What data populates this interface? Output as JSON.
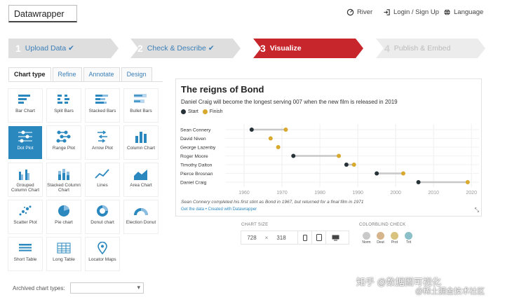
{
  "app": {
    "logo": "Datawrapper",
    "nav": [
      {
        "label": "River",
        "icon": "river-icon"
      },
      {
        "label": "Login / Sign Up",
        "icon": "login-icon"
      },
      {
        "label": "Language",
        "icon": "globe-icon"
      }
    ]
  },
  "steps": [
    {
      "num": "1",
      "label": "Upload Data",
      "state": "done"
    },
    {
      "num": "2",
      "label": "Check & Describe",
      "state": "done"
    },
    {
      "num": "3",
      "label": "Visualize",
      "state": "active"
    },
    {
      "num": "4",
      "label": "Publish & Embed",
      "state": "todo"
    }
  ],
  "tabs": [
    "Chart type",
    "Refine",
    "Annotate",
    "Design"
  ],
  "chart_types": [
    "Bar Chart",
    "Split Bars",
    "Stacked Bars",
    "Bullet Bars",
    "Dot Plot",
    "Range Plot",
    "Arrow Plot",
    "Column Chart",
    "Grouped Column Chart",
    "Stacked Column Chart",
    "Lines",
    "Area Chart",
    "Scatter Plot",
    "Pie chart",
    "Donut chart",
    "Election Donut",
    "Short Table",
    "Long Table",
    "Locator Maps"
  ],
  "selected_chart_type": "Dot Plot",
  "archived_label": "Archived chart types:",
  "colors": {
    "accent": "#c8262d",
    "selected": "#2b88bf",
    "start": "#263238",
    "finish": "#d8a92c",
    "link": "#3b7fb8"
  },
  "preview": {
    "title": "The reigns of Bond",
    "description": "Daniel Craig will become the longest serving 007 when the new film is released in 2019",
    "notes": "Sean Connery completed his first stint as Bond in 1967, but returned for a final film in 1971",
    "source": "Get the data • Created with Datawrapper"
  },
  "chart_data": {
    "type": "scatter",
    "title": "The reigns of Bond",
    "subtitle": "Daniel Craig will become the longest serving 007 when the new film is released in 2019",
    "legend": [
      {
        "name": "Start",
        "color": "#263238"
      },
      {
        "name": "Finish",
        "color": "#d8a92c"
      }
    ],
    "xlim": [
      1955,
      2022
    ],
    "x_ticks": [
      1960,
      1970,
      1980,
      1990,
      2000,
      2010,
      2020
    ],
    "rows": [
      {
        "name": "Sean Connery",
        "start": 1962,
        "finish": 1971
      },
      {
        "name": "David Niven",
        "start": null,
        "finish": 1967
      },
      {
        "name": "George Lazenby",
        "start": null,
        "finish": 1969
      },
      {
        "name": "Roger Moore",
        "start": 1973,
        "finish": 1985
      },
      {
        "name": "Timothy Dalton",
        "start": 1987,
        "finish": 1989
      },
      {
        "name": "Pierce Brosnan",
        "start": 1995,
        "finish": 2002
      },
      {
        "name": "Daniel Craig",
        "start": 2006,
        "finish": 2019
      }
    ]
  },
  "controls": {
    "chart_size_label": "CHART SIZE",
    "width": "728",
    "height": "318",
    "times": "×",
    "colorblind_label": "COLORBLIND CHECK",
    "colorblind": [
      {
        "label": "Norm",
        "color": "#c9c9c9"
      },
      {
        "label": "Deut",
        "color": "#d6b48c"
      },
      {
        "label": "Prot",
        "color": "#d9c27e"
      },
      {
        "label": "Trit",
        "color": "#8cc0c9"
      }
    ]
  },
  "watermark": {
    "line1": "知乎 @数据图可视化",
    "line2": "@稀土掘金技术社区"
  }
}
